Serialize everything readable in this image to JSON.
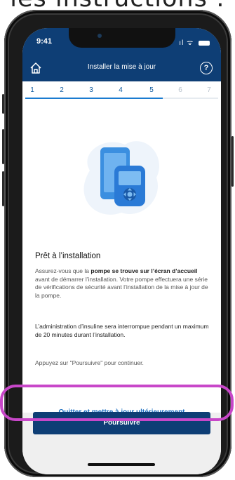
{
  "caption": "les instructions :",
  "status_bar": {
    "time": "9:41",
    "signal": "ıl",
    "wifi": "ᯤ"
  },
  "nav": {
    "title": "Installer la mise à jour",
    "help": "?"
  },
  "steps": {
    "labels": [
      "1",
      "2",
      "3",
      "4",
      "5",
      "6",
      "7"
    ],
    "current": 5
  },
  "content": {
    "title": "Prêt à l’installation",
    "p1_pre": "Assurez-vous que la ",
    "p1_b1": "pompe se trouve sur l’écran d’accueil",
    "p1_post": " avant de démarrer l’installation. Votre pompe effectuera une série de vérifications de sécurité avant l’installation de la mise à jour de la pompe.",
    "p2": "L’administration d’insuline sera interrompue pendant un maximum de 20 minutes durant l’installation.",
    "p3": "Appuyez sur \"Poursuivre\" pour continuer."
  },
  "actions": {
    "later": "Quitter et mettre à jour ultérieurement",
    "continue": "Poursuivre"
  },
  "colors": {
    "navy": "#0e3e75",
    "link": "#1a6ec0",
    "highlight": "#c847c9"
  }
}
